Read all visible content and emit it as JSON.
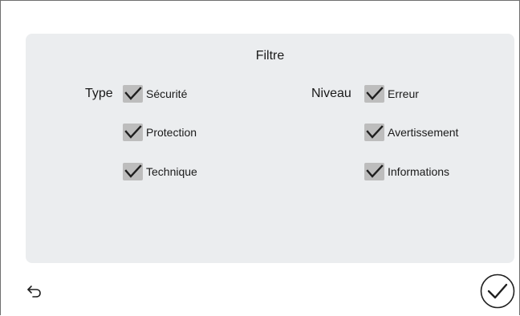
{
  "filter": {
    "title": "Filtre",
    "type_group": {
      "label": "Type",
      "options": [
        {
          "label": "Sécurité",
          "checked": true
        },
        {
          "label": "Protection",
          "checked": true
        },
        {
          "label": "Technique",
          "checked": true
        }
      ]
    },
    "level_group": {
      "label": "Niveau",
      "options": [
        {
          "label": "Erreur",
          "checked": true
        },
        {
          "label": "Avertissement",
          "checked": true
        },
        {
          "label": "Informations",
          "checked": true
        }
      ]
    }
  },
  "footer": {
    "back_icon": "undo-arrow-icon",
    "confirm_icon": "circle-check-icon"
  }
}
